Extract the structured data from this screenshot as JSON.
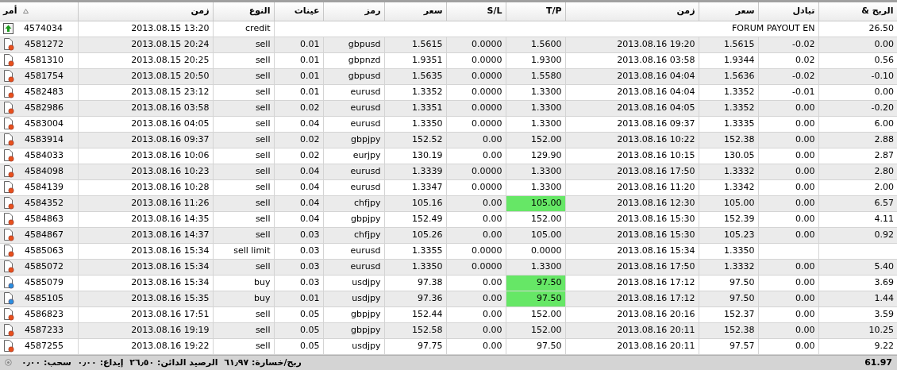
{
  "columns": [
    {
      "label": "الربح &"
    },
    {
      "label": "تبادل"
    },
    {
      "label": "سعر"
    },
    {
      "label": "زمن"
    },
    {
      "label": "T/P"
    },
    {
      "label": "S/L"
    },
    {
      "label": "سعر"
    },
    {
      "label": "رمز"
    },
    {
      "label": "عينات"
    },
    {
      "label": "النوع"
    },
    {
      "label": "زمن"
    },
    {
      "label": "أمر",
      "sorted": true
    }
  ],
  "rows": [
    {
      "kind": "credit",
      "order": "4574034",
      "time": "2013.08.15 13:20",
      "type": "credit",
      "comment": "FORUM PAYOUT EN",
      "profit": "26.50"
    },
    {
      "kind": "sell",
      "order": "4581272",
      "time": "2013.08.15 20:24",
      "type": "sell",
      "lots": "0.01",
      "symbol": "gbpusd",
      "price": "1.5615",
      "sl": "0.0000",
      "tp": "1.5600",
      "tp_hit": false,
      "close_time": "2013.08.16 19:20",
      "close_price": "1.5615",
      "swap": "-0.02",
      "profit": "0.00"
    },
    {
      "kind": "sell",
      "order": "4581310",
      "time": "2013.08.15 20:25",
      "type": "sell",
      "lots": "0.01",
      "symbol": "gbpnzd",
      "price": "1.9351",
      "sl": "0.0000",
      "tp": "1.9300",
      "tp_hit": false,
      "close_time": "2013.08.16 03:58",
      "close_price": "1.9344",
      "swap": "0.02",
      "profit": "0.56"
    },
    {
      "kind": "sell",
      "order": "4581754",
      "time": "2013.08.15 20:50",
      "type": "sell",
      "lots": "0.01",
      "symbol": "gbpusd",
      "price": "1.5635",
      "sl": "0.0000",
      "tp": "1.5580",
      "tp_hit": false,
      "close_time": "2013.08.16 04:04",
      "close_price": "1.5636",
      "swap": "-0.02",
      "profit": "-0.10"
    },
    {
      "kind": "sell",
      "order": "4582483",
      "time": "2013.08.15 23:12",
      "type": "sell",
      "lots": "0.01",
      "symbol": "eurusd",
      "price": "1.3352",
      "sl": "0.0000",
      "tp": "1.3300",
      "tp_hit": false,
      "close_time": "2013.08.16 04:04",
      "close_price": "1.3352",
      "swap": "-0.01",
      "profit": "0.00"
    },
    {
      "kind": "sell",
      "order": "4582986",
      "time": "2013.08.16 03:58",
      "type": "sell",
      "lots": "0.02",
      "symbol": "eurusd",
      "price": "1.3351",
      "sl": "0.0000",
      "tp": "1.3300",
      "tp_hit": false,
      "close_time": "2013.08.16 04:05",
      "close_price": "1.3352",
      "swap": "0.00",
      "profit": "-0.20"
    },
    {
      "kind": "sell",
      "order": "4583004",
      "time": "2013.08.16 04:05",
      "type": "sell",
      "lots": "0.04",
      "symbol": "eurusd",
      "price": "1.3350",
      "sl": "0.0000",
      "tp": "1.3300",
      "tp_hit": false,
      "close_time": "2013.08.16 09:37",
      "close_price": "1.3335",
      "swap": "0.00",
      "profit": "6.00"
    },
    {
      "kind": "sell",
      "order": "4583914",
      "time": "2013.08.16 09:37",
      "type": "sell",
      "lots": "0.02",
      "symbol": "gbpjpy",
      "price": "152.52",
      "sl": "0.00",
      "tp": "152.00",
      "tp_hit": false,
      "close_time": "2013.08.16 10:22",
      "close_price": "152.38",
      "swap": "0.00",
      "profit": "2.88"
    },
    {
      "kind": "sell",
      "order": "4584033",
      "time": "2013.08.16 10:06",
      "type": "sell",
      "lots": "0.02",
      "symbol": "eurjpy",
      "price": "130.19",
      "sl": "0.00",
      "tp": "129.90",
      "tp_hit": false,
      "close_time": "2013.08.16 10:15",
      "close_price": "130.05",
      "swap": "0.00",
      "profit": "2.87"
    },
    {
      "kind": "sell",
      "order": "4584098",
      "time": "2013.08.16 10:23",
      "type": "sell",
      "lots": "0.04",
      "symbol": "eurusd",
      "price": "1.3339",
      "sl": "0.0000",
      "tp": "1.3300",
      "tp_hit": false,
      "close_time": "2013.08.16 17:50",
      "close_price": "1.3332",
      "swap": "0.00",
      "profit": "2.80"
    },
    {
      "kind": "sell",
      "order": "4584139",
      "time": "2013.08.16 10:28",
      "type": "sell",
      "lots": "0.04",
      "symbol": "eurusd",
      "price": "1.3347",
      "sl": "0.0000",
      "tp": "1.3300",
      "tp_hit": false,
      "close_time": "2013.08.16 11:20",
      "close_price": "1.3342",
      "swap": "0.00",
      "profit": "2.00"
    },
    {
      "kind": "sell",
      "order": "4584352",
      "time": "2013.08.16 11:26",
      "type": "sell",
      "lots": "0.04",
      "symbol": "chfjpy",
      "price": "105.16",
      "sl": "0.00",
      "tp": "105.00",
      "tp_hit": true,
      "close_time": "2013.08.16 12:30",
      "close_price": "105.00",
      "swap": "0.00",
      "profit": "6.57"
    },
    {
      "kind": "sell",
      "order": "4584863",
      "time": "2013.08.16 14:35",
      "type": "sell",
      "lots": "0.04",
      "symbol": "gbpjpy",
      "price": "152.49",
      "sl": "0.00",
      "tp": "152.00",
      "tp_hit": false,
      "close_time": "2013.08.16 15:30",
      "close_price": "152.39",
      "swap": "0.00",
      "profit": "4.11"
    },
    {
      "kind": "sell",
      "order": "4584867",
      "time": "2013.08.16 14:37",
      "type": "sell",
      "lots": "0.03",
      "symbol": "chfjpy",
      "price": "105.26",
      "sl": "0.00",
      "tp": "105.00",
      "tp_hit": false,
      "close_time": "2013.08.16 15:30",
      "close_price": "105.23",
      "swap": "0.00",
      "profit": "0.92"
    },
    {
      "kind": "sell",
      "order": "4585063",
      "time": "2013.08.16 15:34",
      "type": "sell limit",
      "lots": "0.03",
      "symbol": "eurusd",
      "price": "1.3355",
      "sl": "0.0000",
      "tp": "0.0000",
      "tp_hit": false,
      "close_time": "2013.08.16 15:34",
      "close_price": "1.3350"
    },
    {
      "kind": "sell",
      "order": "4585072",
      "time": "2013.08.16 15:34",
      "type": "sell",
      "lots": "0.03",
      "symbol": "eurusd",
      "price": "1.3350",
      "sl": "0.0000",
      "tp": "1.3300",
      "tp_hit": false,
      "close_time": "2013.08.16 17:50",
      "close_price": "1.3332",
      "swap": "0.00",
      "profit": "5.40"
    },
    {
      "kind": "buy",
      "order": "4585079",
      "time": "2013.08.16 15:34",
      "type": "buy",
      "lots": "0.03",
      "symbol": "usdjpy",
      "price": "97.38",
      "sl": "0.00",
      "tp": "97.50",
      "tp_hit": true,
      "close_time": "2013.08.16 17:12",
      "close_price": "97.50",
      "swap": "0.00",
      "profit": "3.69"
    },
    {
      "kind": "buy",
      "order": "4585105",
      "time": "2013.08.16 15:35",
      "type": "buy",
      "lots": "0.01",
      "symbol": "usdjpy",
      "price": "97.36",
      "sl": "0.00",
      "tp": "97.50",
      "tp_hit": true,
      "close_time": "2013.08.16 17:12",
      "close_price": "97.50",
      "swap": "0.00",
      "profit": "1.44"
    },
    {
      "kind": "sell",
      "order": "4586823",
      "time": "2013.08.16 17:51",
      "type": "sell",
      "lots": "0.05",
      "symbol": "gbpjpy",
      "price": "152.44",
      "sl": "0.00",
      "tp": "152.00",
      "tp_hit": false,
      "close_time": "2013.08.16 20:16",
      "close_price": "152.37",
      "swap": "0.00",
      "profit": "3.59"
    },
    {
      "kind": "sell",
      "order": "4587233",
      "time": "2013.08.16 19:19",
      "type": "sell",
      "lots": "0.05",
      "symbol": "gbpjpy",
      "price": "152.58",
      "sl": "0.00",
      "tp": "152.00",
      "tp_hit": false,
      "close_time": "2013.08.16 20:11",
      "close_price": "152.38",
      "swap": "0.00",
      "profit": "10.25"
    },
    {
      "kind": "sell",
      "order": "4587255",
      "time": "2013.08.16 19:22",
      "type": "sell",
      "lots": "0.05",
      "symbol": "usdjpy",
      "price": "97.75",
      "sl": "0.00",
      "tp": "97.50",
      "tp_hit": false,
      "close_time": "2013.08.16 20:11",
      "close_price": "97.57",
      "swap": "0.00",
      "profit": "9.22"
    }
  ],
  "status_bar": {
    "summary": "ربح/خسارة: ٦١٫٩٧  الرصيد الدائن: ٢٦٫٥٠  إيداع: ٠٫٠٠  سحب: ٠٫٠٠",
    "total": "61.97"
  }
}
